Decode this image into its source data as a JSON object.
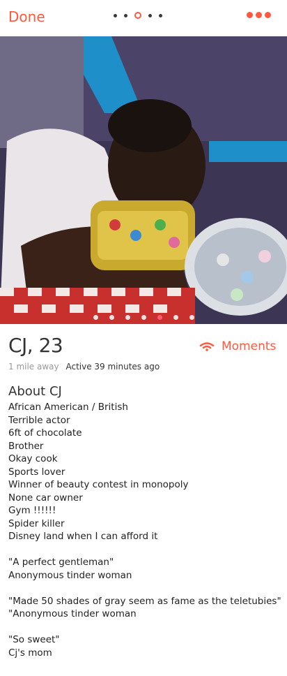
{
  "header": {
    "done_label": "Done",
    "pager_count": 5,
    "pager_active_index": 2,
    "more_icon": "more-dots-icon",
    "accent_color": "#ff5a3f"
  },
  "photo": {
    "dots_count": 7,
    "active_index": 4
  },
  "profile": {
    "name_age": "CJ, 23",
    "moments_label": "Moments",
    "moments_icon": "wifi-icon",
    "distance": "1 mile away",
    "active": "Active 39 minutes ago"
  },
  "about": {
    "title": "About CJ",
    "lines": [
      "African American / British",
      "Terrible actor",
      "6ft of chocolate",
      "Brother",
      "Okay cook",
      "Sports lover",
      "Winner of beauty contest in monopoly",
      "None car owner",
      "Gym !!!!!!",
      "Spider killer",
      "Disney land when I can afford it",
      "",
      "\"A perfect gentleman\"",
      "Anonymous tinder woman",
      "",
      "\"Made 50 shades of gray seem as fame as the teletubies\"",
      "\"Anonymous tinder woman",
      "",
      "\"So sweet\"",
      "Cj's mom"
    ]
  }
}
